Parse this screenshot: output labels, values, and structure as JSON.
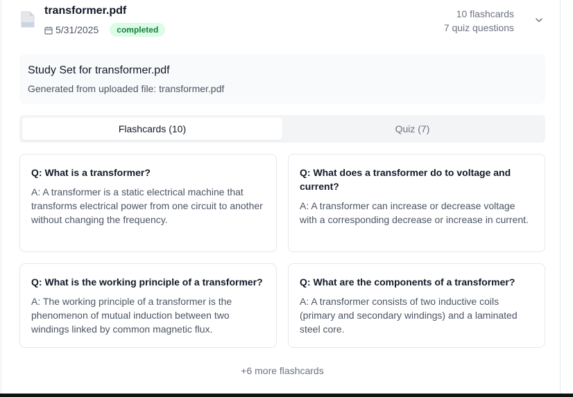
{
  "file": {
    "name": "transformer.pdf",
    "date": "5/31/2025",
    "status": "completed",
    "flashcards_count": "10 flashcards",
    "quiz_count": "7 quiz questions"
  },
  "study_set": {
    "title": "Study Set for transformer.pdf",
    "subtitle": "Generated from uploaded file: transformer.pdf"
  },
  "tabs": [
    {
      "label": "Flashcards (10)",
      "active": true
    },
    {
      "label": "Quiz (7)",
      "active": false
    }
  ],
  "flashcards": [
    {
      "q": "Q: What is a transformer?",
      "a": "A: A transformer is a static electrical machine that transforms electrical power from one circuit to another without changing the frequency."
    },
    {
      "q": "Q: What does a transformer do to voltage and current?",
      "a": "A: A transformer can increase or decrease voltage with a corresponding decrease or increase in current."
    },
    {
      "q": "Q: What is the working principle of a transformer?",
      "a": "A: The working principle of a transformer is the phenomenon of mutual induction between two windings linked by common magnetic flux."
    },
    {
      "q": "Q: What are the components of a transformer?",
      "a": "A: A transformer consists of two inductive coils (primary and secondary windings) and a laminated steel core."
    }
  ],
  "more_label": "+6 more flashcards",
  "colors": {
    "badge_bg": "#dcfce7",
    "badge_text": "#15803d",
    "tab_bg": "#f3f4f6",
    "info_bg": "#f9fafb"
  },
  "icons": {
    "file": "file-icon",
    "date": "calendar-icon",
    "expand": "chevron-down-icon"
  }
}
